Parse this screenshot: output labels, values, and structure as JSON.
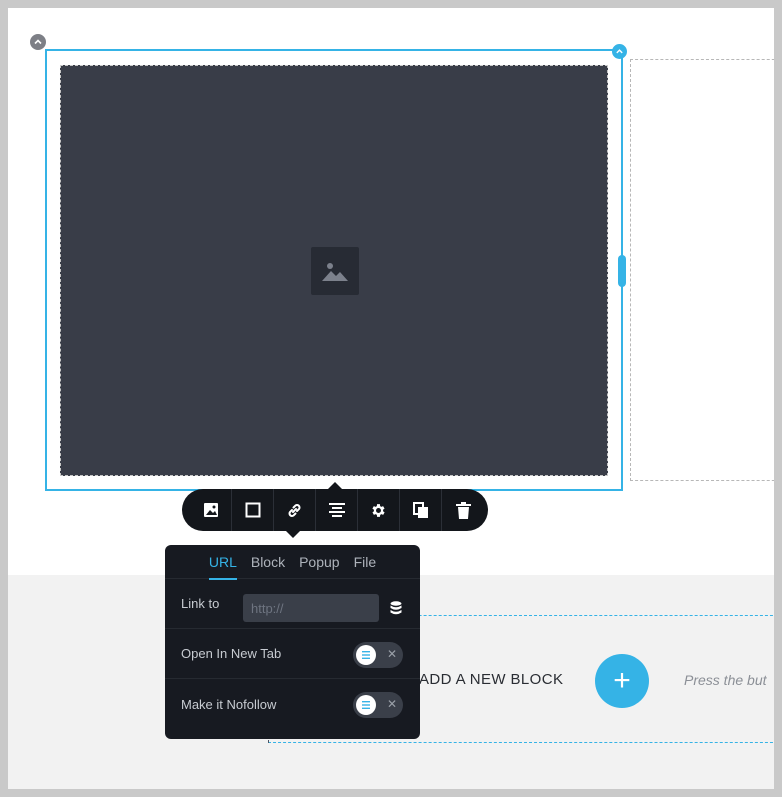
{
  "toolbar": {
    "icons": [
      "image-icon",
      "border-icon",
      "link-icon",
      "align-center-icon",
      "gear-icon",
      "duplicate-icon",
      "trash-icon"
    ]
  },
  "link_panel": {
    "tabs": [
      {
        "label": "URL",
        "active": true
      },
      {
        "label": "Block",
        "active": false
      },
      {
        "label": "Popup",
        "active": false
      },
      {
        "label": "File",
        "active": false
      }
    ],
    "link_to": {
      "label": "Link to",
      "placeholder": "http://",
      "value": ""
    },
    "open_new_tab": {
      "label": "Open In New Tab",
      "enabled": false
    },
    "nofollow": {
      "label": "Make it Nofollow",
      "enabled": false
    }
  },
  "add_block": {
    "label": "ADD A NEW BLOCK",
    "button": "+",
    "hint": "Press the but"
  },
  "colors": {
    "accent": "#35b3e6",
    "toolbar_bg": "#13161b",
    "image_placeholder_bg": "#393d48"
  }
}
